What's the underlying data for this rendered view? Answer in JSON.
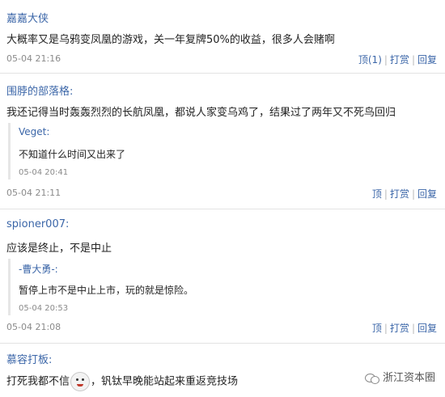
{
  "comments": [
    {
      "author": "嘉嘉大侠",
      "text": "大概率又是乌鸦变凤凰的游戏，关一年复牌50%的收益，很多人会赌啊",
      "time": "05-04 21:16",
      "actions": {
        "top": "顶(1)",
        "reward": "打赏",
        "reply": "回复"
      }
    },
    {
      "author": "围脖的部落格:",
      "text": "我还记得当时轰轰烈烈的长航凤凰，都说人家变乌鸡了，结果过了两年又不死鸟回归",
      "quote": {
        "author": "Veget:",
        "text": "不知道什么时间又出来了",
        "time": "05-04 20:41"
      },
      "time": "05-04 21:11",
      "actions": {
        "top": "顶",
        "reward": "打赏",
        "reply": "回复"
      }
    },
    {
      "author": "spioner007:",
      "text": "应该是终止，不是中止",
      "quote": {
        "author": "-曹大勇-:",
        "text": "暂停上市不是中止上市，玩的就是惊险。",
        "time": "05-04 20:53"
      },
      "time": "05-04 21:08",
      "actions": {
        "top": "顶",
        "reward": "打赏",
        "reply": "回复"
      }
    },
    {
      "author": "慕容打板:",
      "text_before": "打死我都不信",
      "emoji": "laughing-face-emoji",
      "text_after": "，钒钛早晚能站起来重返竞技场"
    }
  ],
  "watermark": {
    "icon": "wechat-icon",
    "text": "浙江资本圈"
  }
}
